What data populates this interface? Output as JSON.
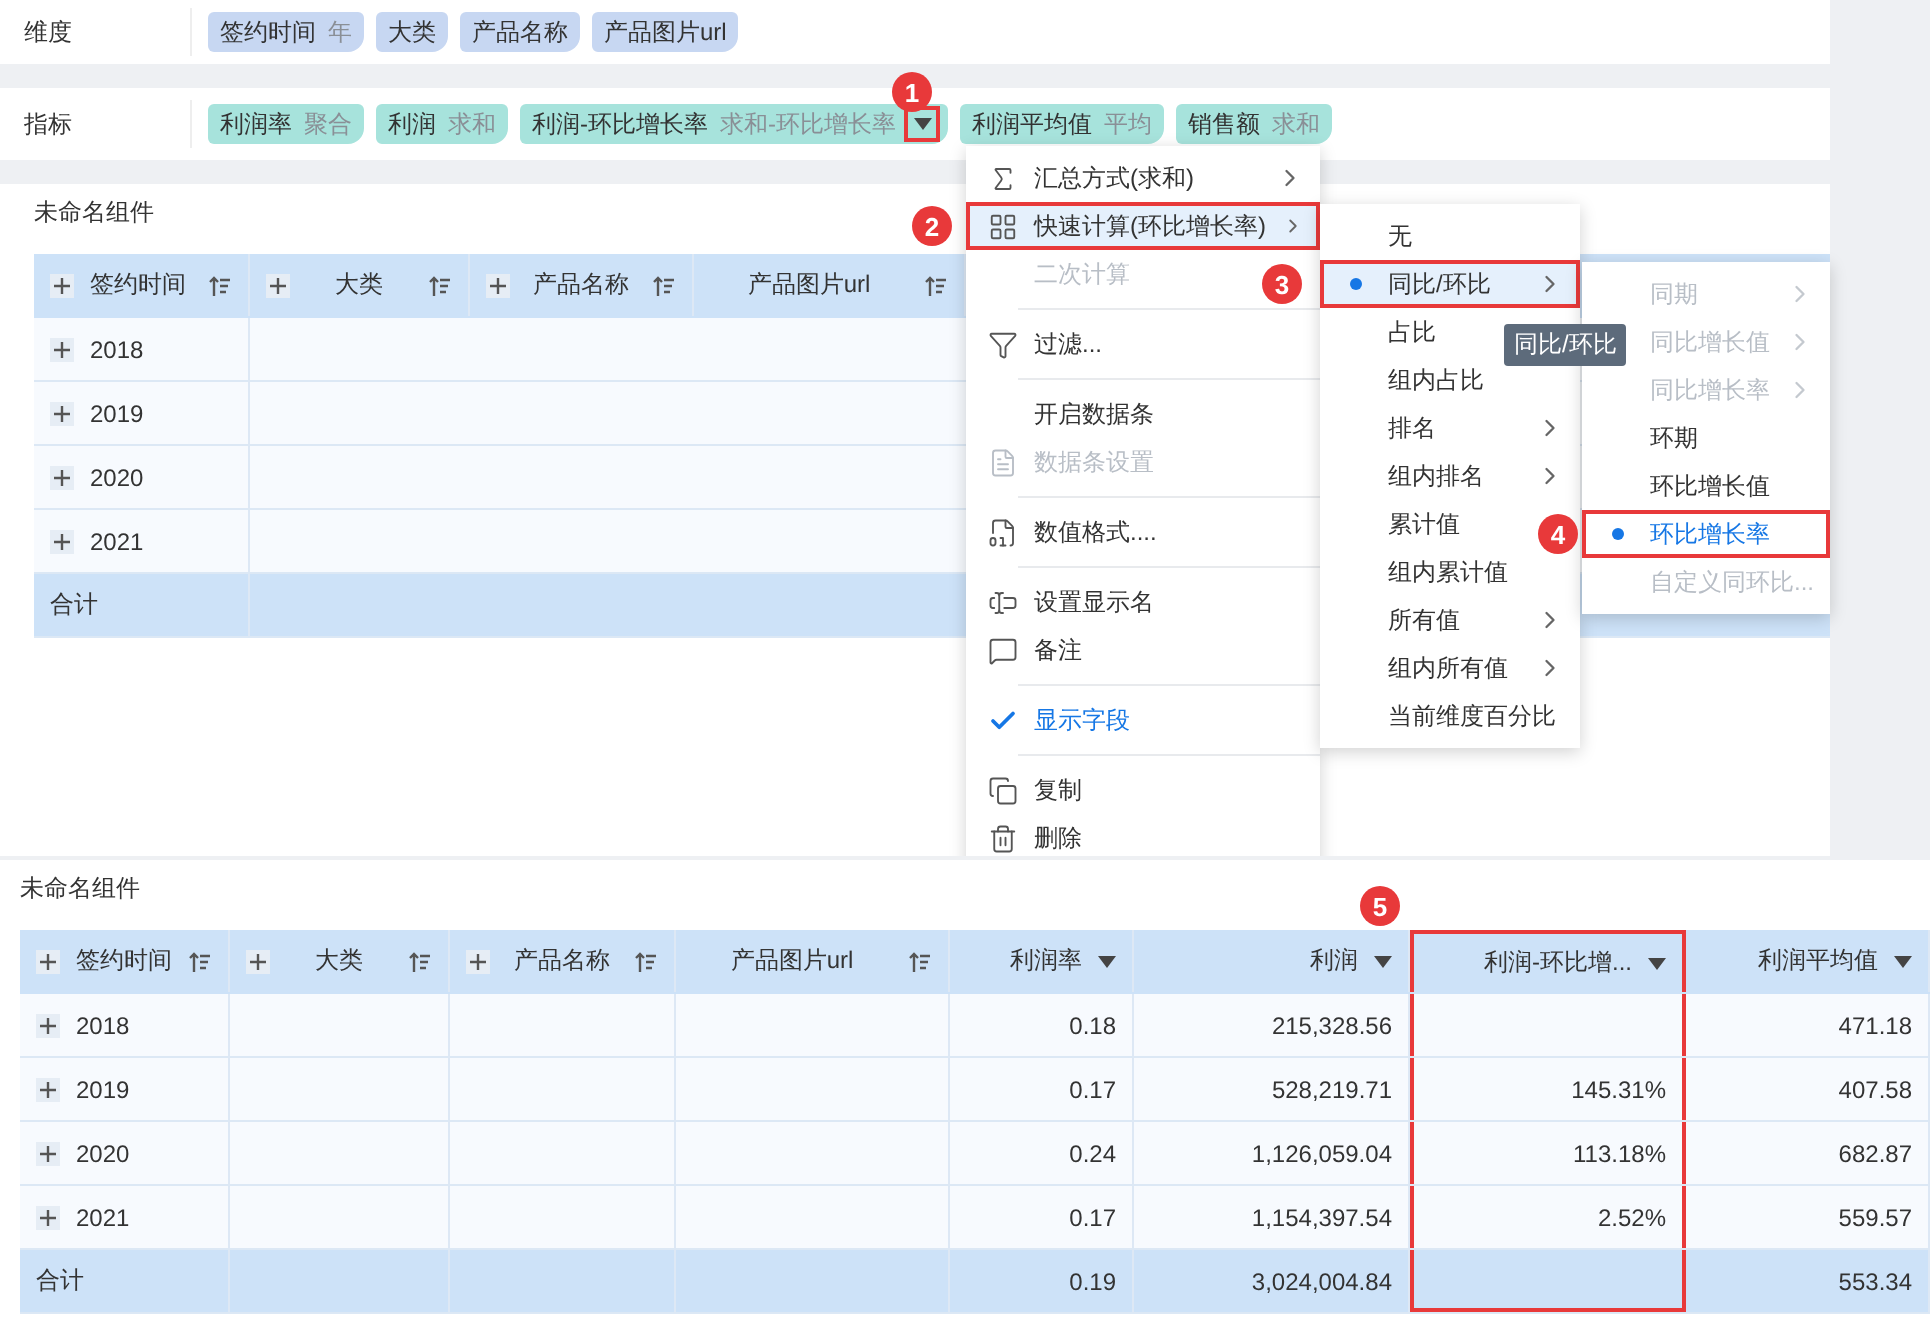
{
  "dimensions": {
    "label": "维度",
    "fields": [
      {
        "name": "签约时间",
        "agg": "年"
      },
      {
        "name": "大类"
      },
      {
        "name": "产品名称"
      },
      {
        "name": "产品图片url"
      }
    ]
  },
  "metrics": {
    "label": "指标",
    "fields": [
      {
        "name": "利润率",
        "agg": "聚合"
      },
      {
        "name": "利润",
        "agg": "求和"
      },
      {
        "name": "利润-环比增长率",
        "agg": "求和-环比增长率",
        "menu_open": true,
        "callout": "1"
      },
      {
        "name": "利润平均值",
        "agg": "平均"
      },
      {
        "name": "销售额",
        "agg": "求和"
      }
    ]
  },
  "top_widget": {
    "title": "未命名组件",
    "columns": [
      "签约时间",
      "大类",
      "产品名称",
      "产品图片url"
    ],
    "rows": [
      "2018",
      "2019",
      "2020",
      "2021"
    ],
    "total": "合计"
  },
  "context_menu": {
    "items": [
      {
        "kind": "item",
        "label": "汇总方式(求和)",
        "has_submenu": true,
        "disabled": false,
        "highlighted": false,
        "checked": false
      },
      {
        "kind": "item",
        "label": "快速计算(环比增长率)",
        "has_submenu": true,
        "disabled": false,
        "highlighted": true,
        "checked": false,
        "callout": "2"
      },
      {
        "kind": "item",
        "label": "二次计算",
        "has_submenu": false,
        "disabled": true,
        "highlighted": false,
        "checked": false
      },
      {
        "kind": "divider"
      },
      {
        "kind": "item",
        "label": "过滤...",
        "has_submenu": false,
        "disabled": false,
        "highlighted": false,
        "checked": false
      },
      {
        "kind": "divider"
      },
      {
        "kind": "item",
        "label": "开启数据条",
        "has_submenu": false,
        "disabled": false,
        "highlighted": false,
        "checked": false
      },
      {
        "kind": "item",
        "label": "数据条设置",
        "has_submenu": false,
        "disabled": true,
        "highlighted": false,
        "checked": false
      },
      {
        "kind": "divider"
      },
      {
        "kind": "item",
        "label": "数值格式....",
        "has_submenu": false,
        "disabled": false,
        "highlighted": false,
        "checked": false
      },
      {
        "kind": "divider"
      },
      {
        "kind": "item",
        "label": "设置显示名",
        "has_submenu": false,
        "disabled": false,
        "highlighted": false,
        "checked": false
      },
      {
        "kind": "item",
        "label": "备注",
        "has_submenu": false,
        "disabled": false,
        "highlighted": false,
        "checked": false
      },
      {
        "kind": "divider"
      },
      {
        "kind": "item",
        "label": "显示字段",
        "has_submenu": false,
        "disabled": false,
        "highlighted": false,
        "checked": true
      },
      {
        "kind": "divider"
      },
      {
        "kind": "item",
        "label": "复制",
        "has_submenu": false,
        "disabled": false,
        "highlighted": false,
        "checked": false
      },
      {
        "kind": "item",
        "label": "删除",
        "has_submenu": false,
        "disabled": false,
        "highlighted": false,
        "checked": false
      }
    ]
  },
  "quick_calc_menu": {
    "tooltip": "同比/环比",
    "items": [
      {
        "label": "无",
        "selected": false,
        "has_submenu": false
      },
      {
        "label": "同比/环比",
        "selected": true,
        "has_submenu": true,
        "callout": "3"
      },
      {
        "label": "占比",
        "selected": false,
        "has_submenu": false
      },
      {
        "label": "组内占比",
        "selected": false,
        "has_submenu": false
      },
      {
        "label": "排名",
        "selected": false,
        "has_submenu": true
      },
      {
        "label": "组内排名",
        "selected": false,
        "has_submenu": true
      },
      {
        "label": "累计值",
        "selected": false,
        "has_submenu": false
      },
      {
        "label": "组内累计值",
        "selected": false,
        "has_submenu": false
      },
      {
        "label": "所有值",
        "selected": false,
        "has_submenu": true
      },
      {
        "label": "组内所有值",
        "selected": false,
        "has_submenu": true
      },
      {
        "label": "当前维度百分比",
        "selected": false,
        "has_submenu": false
      }
    ]
  },
  "comparison_menu": {
    "items": [
      {
        "label": "同期",
        "selected": false,
        "disabled": true,
        "has_submenu": true
      },
      {
        "label": "同比增长值",
        "selected": false,
        "disabled": true,
        "has_submenu": true
      },
      {
        "label": "同比增长率",
        "selected": false,
        "disabled": true,
        "has_submenu": true
      },
      {
        "label": "环期",
        "selected": false,
        "disabled": false,
        "has_submenu": false
      },
      {
        "label": "环比增长值",
        "selected": false,
        "disabled": false,
        "has_submenu": false
      },
      {
        "label": "环比增长率",
        "selected": true,
        "disabled": false,
        "has_submenu": false,
        "callout": "4"
      },
      {
        "label": "自定义同环比...",
        "selected": false,
        "disabled": true,
        "has_submenu": false
      }
    ]
  },
  "bottom_widget": {
    "title": "未命名组件",
    "columns": [
      {
        "label": "签约时间",
        "kind": "dimension"
      },
      {
        "label": "大类",
        "kind": "dimension"
      },
      {
        "label": "产品名称",
        "kind": "dimension"
      },
      {
        "label": "产品图片url",
        "kind": "dimension"
      },
      {
        "label": "利润率",
        "kind": "measure"
      },
      {
        "label": "利润",
        "kind": "measure"
      },
      {
        "label": "利润-环比增...",
        "kind": "measure",
        "callout": "5"
      },
      {
        "label": "利润平均值",
        "kind": "measure"
      }
    ],
    "rows": [
      {
        "label": "2018",
        "profit_rate": "0.18",
        "profit": "215,328.56",
        "profit_avg": "471.18"
      },
      {
        "label": "2019",
        "profit_rate": "0.17",
        "profit": "528,219.71",
        "profit_growth": "145.31%",
        "profit_avg": "407.58"
      },
      {
        "label": "2020",
        "profit_rate": "0.24",
        "profit": "1,126,059.04",
        "profit_growth": "113.18%",
        "profit_avg": "682.87"
      },
      {
        "label": "2021",
        "profit_rate": "0.17",
        "profit": "1,154,397.54",
        "profit_growth": "2.52%",
        "profit_avg": "559.57"
      }
    ],
    "total": {
      "label": "合计",
      "profit_rate": "0.19",
      "profit": "3,024,004.84",
      "profit_avg": "553.34"
    }
  }
}
